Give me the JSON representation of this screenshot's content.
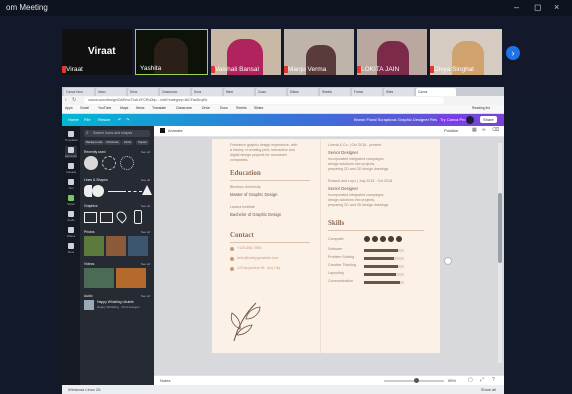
{
  "zoom": {
    "title": "om Meeting",
    "window_controls": [
      "–",
      "◻",
      "×"
    ],
    "participants": [
      {
        "name": "Viraat",
        "big_label": "Viraat"
      },
      {
        "name": "Yashita"
      },
      {
        "name": "Vaishali Bansal"
      },
      {
        "name": "Manju Verma"
      },
      {
        "name": "LOKITA JAIN"
      },
      {
        "name": "Divya Singhal"
      }
    ],
    "next_icon": "chevron-right-icon"
  },
  "browser": {
    "address": "canva.com/design/DAEmoTJsb1/FCRu0bp…/edit?category=tACFasDnyKk",
    "tabs": [
      "Canva Hom",
      "Inbox",
      "Drive",
      "Classroom",
      "Docs",
      "Meet",
      "Zoom",
      "Slides",
      "Sheets",
      "Forms",
      "Sites",
      "Canva"
    ],
    "bookmarks": [
      "Apps",
      "Gmail",
      "YouTube",
      "Maps",
      "News",
      "Translate",
      "Classroom",
      "Drive",
      "Docs",
      "Sheets",
      "Slides",
      "Reading list"
    ]
  },
  "canva": {
    "top_left": [
      "Home",
      "File",
      "Resize",
      "↶",
      "↷"
    ],
    "top_right_title": "Brown Floral Scrapbook Graphic Designer Resume",
    "share_label": "Share",
    "present_label": "Try Canva Pro",
    "rail": [
      "Templates",
      "Elements",
      "Uploads",
      "Text",
      "Styles",
      "Audio",
      "Videos",
      "More"
    ],
    "search_placeholder": "Search icons and shapes",
    "chips": [
      "Backgrounds",
      "Christmas",
      "Circle",
      "Square"
    ],
    "sections": [
      {
        "title": "Recently used",
        "see": "See all"
      },
      {
        "title": "Lines & Shapes",
        "see": "See all"
      },
      {
        "title": "Graphics",
        "see": "See all"
      },
      {
        "title": "Photos",
        "see": "See all"
      },
      {
        "title": "Videos",
        "see": "See all"
      },
      {
        "title": "Audio",
        "see": "See all"
      }
    ],
    "audio_item": {
      "title": "Happy Whistling Ukulele",
      "meta": "Happy Whistling · Chris Haugen"
    },
    "editor_left": "Animate",
    "editor_right": "Position",
    "footer_left": "Notes",
    "zoom_value": "95%",
    "resume": {
      "about_lines": [
        "Freelance graphic design experience, with",
        "a history of creating print, interactive and",
        "digital design projects for renowned",
        "companies."
      ],
      "education_title": "Education",
      "edu": [
        {
          "school": "Birchtow University",
          "degree": "Master of Graphic Design"
        },
        {
          "school": "Larana Institute",
          "degree": "Bachelor of Graphic Design"
        }
      ],
      "contact_title": "Contact",
      "contact": [
        "+123-456-7890",
        "hello@reallygreatsite.com",
        "123 Anywhere St., Any City"
      ],
      "jobs": [
        {
          "period": "Liceria & Co. | Oct 2018 - present",
          "role": "Senior Designer",
          "desc": [
            "Incorporated integrated campaigns",
            "design solutions into projects,",
            "preparing 2D and 3D design drawings"
          ]
        },
        {
          "period": "Rosanil and Lupo | July 2015 - Oct 2018",
          "role": "Senior Designer",
          "desc": [
            "Incorporated integrated campaigns",
            "design solutions into projects,",
            "preparing 2D and 3D design drawings"
          ]
        }
      ],
      "skills_title": "Skills",
      "skills": [
        {
          "label": "Computer",
          "dots": 5
        },
        {
          "label": "Software",
          "level": 0.85
        },
        {
          "label": "Problem Solving",
          "level": 0.75
        },
        {
          "label": "Creative Thinking",
          "level": 0.85
        },
        {
          "label": "Layouting",
          "level": 0.8
        },
        {
          "label": "Communication",
          "level": 0.9
        }
      ]
    }
  },
  "taskbar": {
    "item": "Windows Linux 26",
    "right": "Show all"
  }
}
